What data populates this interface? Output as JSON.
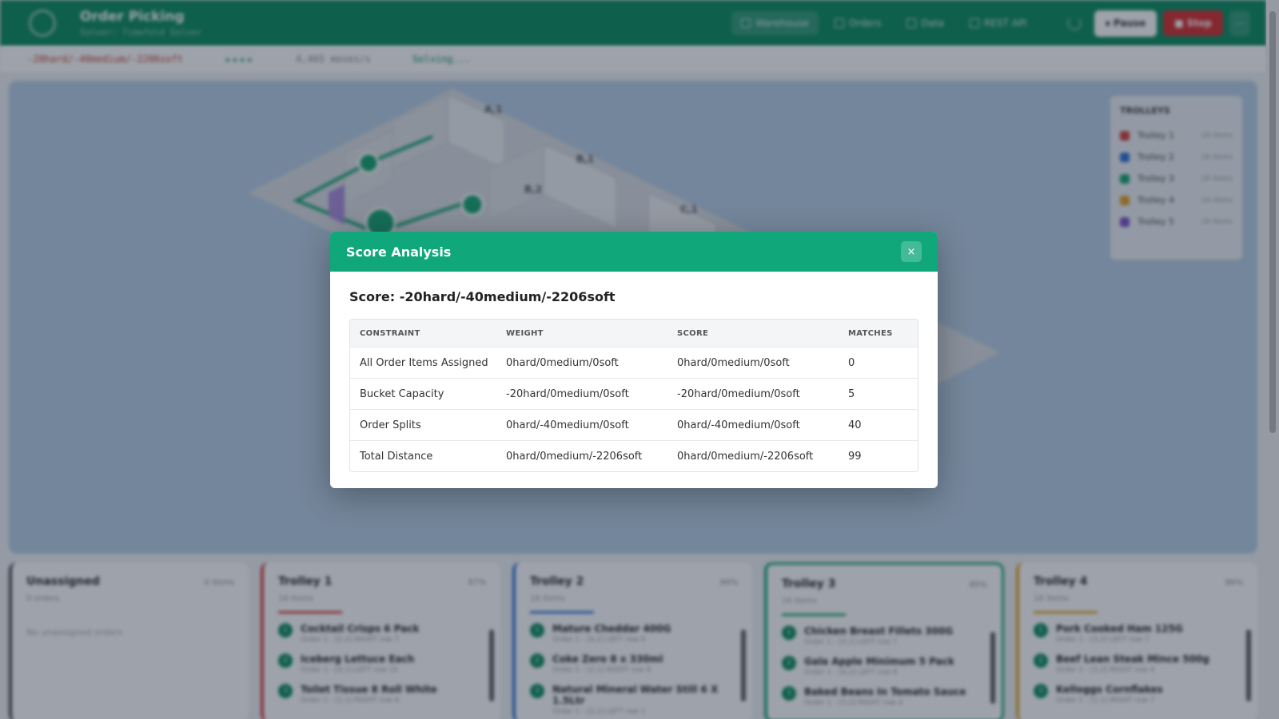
{
  "app": {
    "title": "Order Picking",
    "subtitle": "Solver: Timefold Solver"
  },
  "nav": {
    "tabs": [
      {
        "label": "Warehouse"
      },
      {
        "label": "Orders"
      },
      {
        "label": "Data"
      },
      {
        "label": "REST API"
      }
    ]
  },
  "actions": {
    "pause_label": "⏸ Pause",
    "stop_label": "■ Stop",
    "extra_label": "⋯"
  },
  "status": {
    "score": "-20hard/-40medium/-2206soft",
    "stars": "★★★★",
    "speed": "4,465 moves/s",
    "state": "Solving..."
  },
  "warehouse": {
    "shelf_labels": [
      "A,1",
      "B,1",
      "B,2",
      "C,1"
    ],
    "legend": {
      "title": "TROLLEYS",
      "items": [
        {
          "name": "Trolley 1",
          "count": "16 items",
          "color": "#d43b3b"
        },
        {
          "name": "Trolley 2",
          "count": "16 items",
          "color": "#2d6fd6"
        },
        {
          "name": "Trolley 3",
          "count": "16 items",
          "color": "#14a36f"
        },
        {
          "name": "Trolley 4",
          "count": "16 items",
          "color": "#e0a020"
        },
        {
          "name": "Trolley 5",
          "count": "16 items",
          "color": "#7b4fc9"
        }
      ]
    }
  },
  "cards": {
    "unassigned": {
      "title": "Unassigned",
      "count": "0 items",
      "sub": "0 orders",
      "empty": "No unassigned orders"
    },
    "trolleys": [
      {
        "title": "Trolley 1",
        "pct": "87%",
        "sub": "16 items",
        "color": "#d43b3b",
        "items": [
          {
            "n": "1",
            "name": "Cocktail Crisps 6 Pack",
            "detail": "Order 1 - [2,2] RIGHT row 7"
          },
          {
            "n": "2",
            "name": "Iceberg Lettuce Each",
            "detail": "Order 1 - [4,1] LEFT row 10"
          },
          {
            "n": "3",
            "name": "Toilet Tissue 8 Roll White",
            "detail": "Order 1 - [1,1] RIGHT row 6"
          }
        ]
      },
      {
        "title": "Trolley 2",
        "pct": "86%",
        "sub": "16 items",
        "color": "#2d6fd6",
        "items": [
          {
            "n": "1",
            "name": "Mature Cheddar 400G",
            "detail": "Order 1 - [4,2] LEFT row 6"
          },
          {
            "n": "2",
            "name": "Coke Zero 8 x 330ml",
            "detail": "Order 1 - [2,1] RIGHT row 8"
          },
          {
            "n": "3",
            "name": "Natural Mineral Water Still 6 X 1.5Ltr",
            "detail": "Order 1 - [2,1] LEFT row 1"
          }
        ]
      },
      {
        "title": "Trolley 3",
        "pct": "85%",
        "sub": "16 items",
        "color": "#14a36f",
        "items": [
          {
            "n": "1",
            "name": "Chicken Breast Fillets 300G",
            "detail": "Order 1 - [3,1] LEFT row 7"
          },
          {
            "n": "2",
            "name": "Gala Apple Minimum 5 Pack",
            "detail": "Order 1 - [4,2] LEFT row 8"
          },
          {
            "n": "3",
            "name": "Baked Beans In Tomato Sauce",
            "detail": "Order 1 - [3,2] RIGHT row 4"
          }
        ]
      },
      {
        "title": "Trolley 4",
        "pct": "86%",
        "sub": "16 items",
        "color": "#e0a020",
        "items": [
          {
            "n": "1",
            "name": "Pork Cooked Ham 125G",
            "detail": "Order 1 - [3,2] LEFT row 7"
          },
          {
            "n": "2",
            "name": "Beef Lean Steak Mince 500g",
            "detail": "Order 1 - [3,2] RIGHT row 4"
          },
          {
            "n": "3",
            "name": "Kelloggs Cornflakes",
            "detail": "Order 1 - [1,1] RIGHT row 7"
          }
        ]
      }
    ]
  },
  "modal": {
    "title": "Score Analysis",
    "close_label": "×",
    "score_heading": "Score: -20hard/-40medium/-2206soft",
    "columns": [
      "CONSTRAINT",
      "WEIGHT",
      "SCORE",
      "MATCHES"
    ],
    "rows": [
      {
        "constraint": "All Order Items Assigned",
        "weight": "0hard/0medium/0soft",
        "score": "0hard/0medium/0soft",
        "matches": "0"
      },
      {
        "constraint": "Bucket Capacity",
        "weight": "-20hard/0medium/0soft",
        "score": "-20hard/0medium/0soft",
        "matches": "5"
      },
      {
        "constraint": "Order Splits",
        "weight": "0hard/-40medium/0soft",
        "score": "0hard/-40medium/0soft",
        "matches": "40"
      },
      {
        "constraint": "Total Distance",
        "weight": "0hard/0medium/-2206soft",
        "score": "0hard/0medium/-2206soft",
        "matches": "99"
      }
    ]
  }
}
